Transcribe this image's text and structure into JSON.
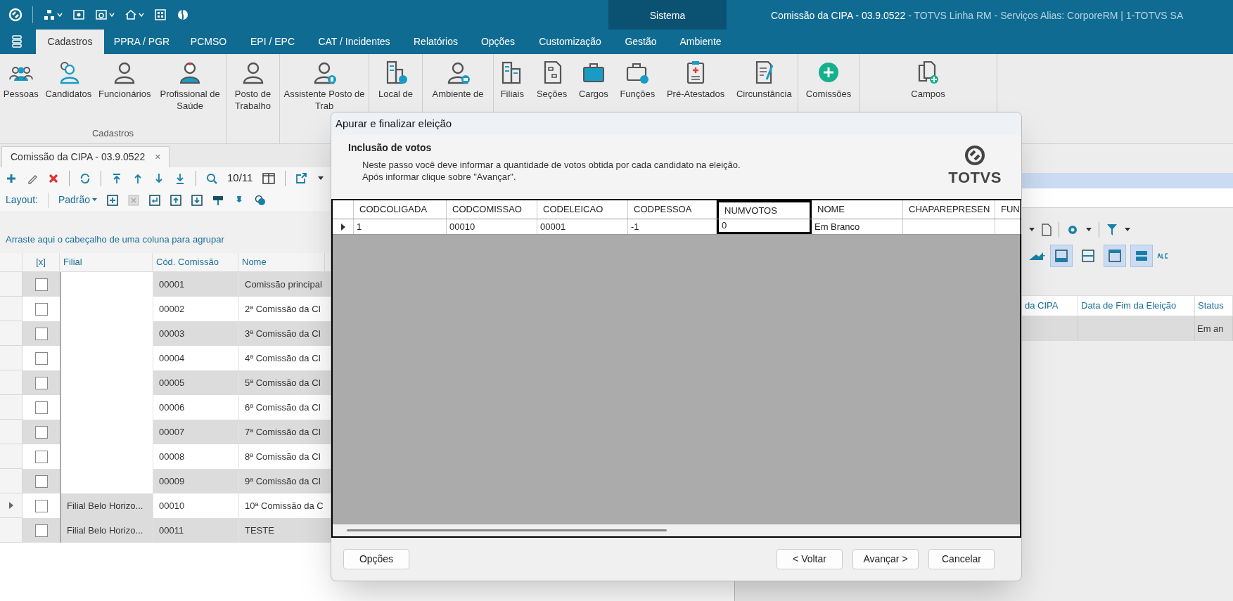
{
  "title_bar": {
    "context_tab": "Sistema",
    "document_title": "Comissão da CIPA - 03.9.0522",
    "app_info": "- TOTVS Linha RM - Serviços  Alias: CorporeRM | 1-TOTVS SA"
  },
  "menu_tabs": [
    {
      "label": "Cadastros",
      "selected": true
    },
    {
      "label": "PPRA / PGR",
      "selected": false
    },
    {
      "label": "PCMSO",
      "selected": false
    },
    {
      "label": "EPI / EPC",
      "selected": false
    },
    {
      "label": "CAT / Incidentes",
      "selected": false
    },
    {
      "label": "Relatórios",
      "selected": false
    },
    {
      "label": "Opções",
      "selected": false
    },
    {
      "label": "Customização",
      "selected": false
    },
    {
      "label": "Gestão",
      "selected": false
    },
    {
      "label": "Ambiente",
      "selected": false
    }
  ],
  "ribbon": {
    "groups": [
      {
        "label": "Cadastros",
        "items": [
          {
            "label": "Pessoas"
          },
          {
            "label": "Candidatos"
          },
          {
            "label": "Funcionários"
          },
          {
            "label": "Profissional de Saúde"
          }
        ]
      },
      {
        "items": [
          {
            "label": "Posto de Trabalho"
          }
        ]
      },
      {
        "items": [
          {
            "label": "Assistente Posto de Trab"
          }
        ]
      },
      {
        "items": [
          {
            "label": "Local de"
          }
        ]
      },
      {
        "items": [
          {
            "label": "Ambiente de"
          }
        ]
      },
      {
        "items": [
          {
            "label": "Filiais"
          },
          {
            "label": "Seções"
          },
          {
            "label": "Cargos"
          },
          {
            "label": "Funções"
          },
          {
            "label": "Pré-Atestados"
          },
          {
            "label": "Circunstância"
          }
        ]
      },
      {
        "items": [
          {
            "label": "Comissões"
          }
        ]
      },
      {
        "items": [
          {
            "label": "Campos"
          }
        ]
      }
    ]
  },
  "document_tab": {
    "label": "Comissão da CIPA - 03.9.0522",
    "close": "×"
  },
  "toolbar": {
    "record_position": "10/11"
  },
  "layout_bar": {
    "label": "Layout:",
    "layout": "Padrão"
  },
  "group_hint": "Arraste aqui o cabeçalho de uma coluna para agrupar",
  "table": {
    "columns": [
      "[x]",
      "Filial",
      "Cód. Comissão",
      "Nome"
    ],
    "rows": [
      {
        "checked": false,
        "selected": false,
        "filial": "",
        "code": "00001",
        "name": "Comissão principal"
      },
      {
        "checked": false,
        "selected": false,
        "filial": "",
        "code": "00002",
        "name": "2ª Comissão da CI"
      },
      {
        "checked": false,
        "selected": false,
        "filial": "",
        "code": "00003",
        "name": "3ª Comissão da CI"
      },
      {
        "checked": false,
        "selected": false,
        "filial": "",
        "code": "00004",
        "name": "4ª Comissão da CI"
      },
      {
        "checked": false,
        "selected": false,
        "filial": "",
        "code": "00005",
        "name": "5ª Comissão da CI"
      },
      {
        "checked": false,
        "selected": false,
        "filial": "",
        "code": "00006",
        "name": "6ª Comissão da CI"
      },
      {
        "checked": false,
        "selected": false,
        "filial": "",
        "code": "00007",
        "name": "7ª Comissão da CI"
      },
      {
        "checked": false,
        "selected": false,
        "filial": "",
        "code": "00008",
        "name": "8ª Comissão da CI"
      },
      {
        "checked": false,
        "selected": false,
        "filial": "",
        "code": "00009",
        "name": "9ª Comissão da CI"
      },
      {
        "checked": false,
        "selected": true,
        "filial": "Filial Belo Horizo...",
        "code": "00010",
        "name": "10ª Comissão da C"
      },
      {
        "checked": false,
        "selected": false,
        "filial": "Filial Belo Horizo...",
        "code": "00011",
        "name": "TESTE"
      }
    ]
  },
  "right_panel": {
    "columns": [
      "da CIPA",
      "Data de Fim da Eleição",
      "Status"
    ],
    "rows": [
      [
        "",
        "",
        "Em an"
      ]
    ]
  },
  "dialog": {
    "title": "Apurar e finalizar eleição",
    "heading": "Inclusão de votos",
    "description_lines": [
      "Neste passo você deve informar a quantidade de votos obtida por cada candidato na eleição.",
      "Após informar clique sobre \"Avançar\"."
    ],
    "logo_text": "TOTVS",
    "grid": {
      "columns": [
        {
          "label": "CODCOLIGADA",
          "highlighted": false
        },
        {
          "label": "CODCOMISSAO",
          "highlighted": false
        },
        {
          "label": "CODELEICAO",
          "highlighted": false
        },
        {
          "label": "CODPESSOA",
          "highlighted": false
        },
        {
          "label": "NUMVOTOS",
          "highlighted": true
        },
        {
          "label": "NOME",
          "highlighted": false
        },
        {
          "label": "CHAPAREPRESEN",
          "highlighted": false
        },
        {
          "label": "FUN",
          "highlighted": false
        }
      ],
      "rows": [
        {
          "selected": true,
          "cells": [
            "1",
            "00010",
            "00001",
            "-1",
            "0",
            "Em Branco",
            "",
            ""
          ]
        }
      ]
    },
    "buttons": [
      {
        "label": "Opções",
        "kind": "left"
      },
      {
        "label": "< Voltar",
        "kind": "right"
      },
      {
        "label": "Avançar >",
        "kind": "right"
      },
      {
        "label": "Cancelar",
        "kind": "right"
      }
    ]
  }
}
